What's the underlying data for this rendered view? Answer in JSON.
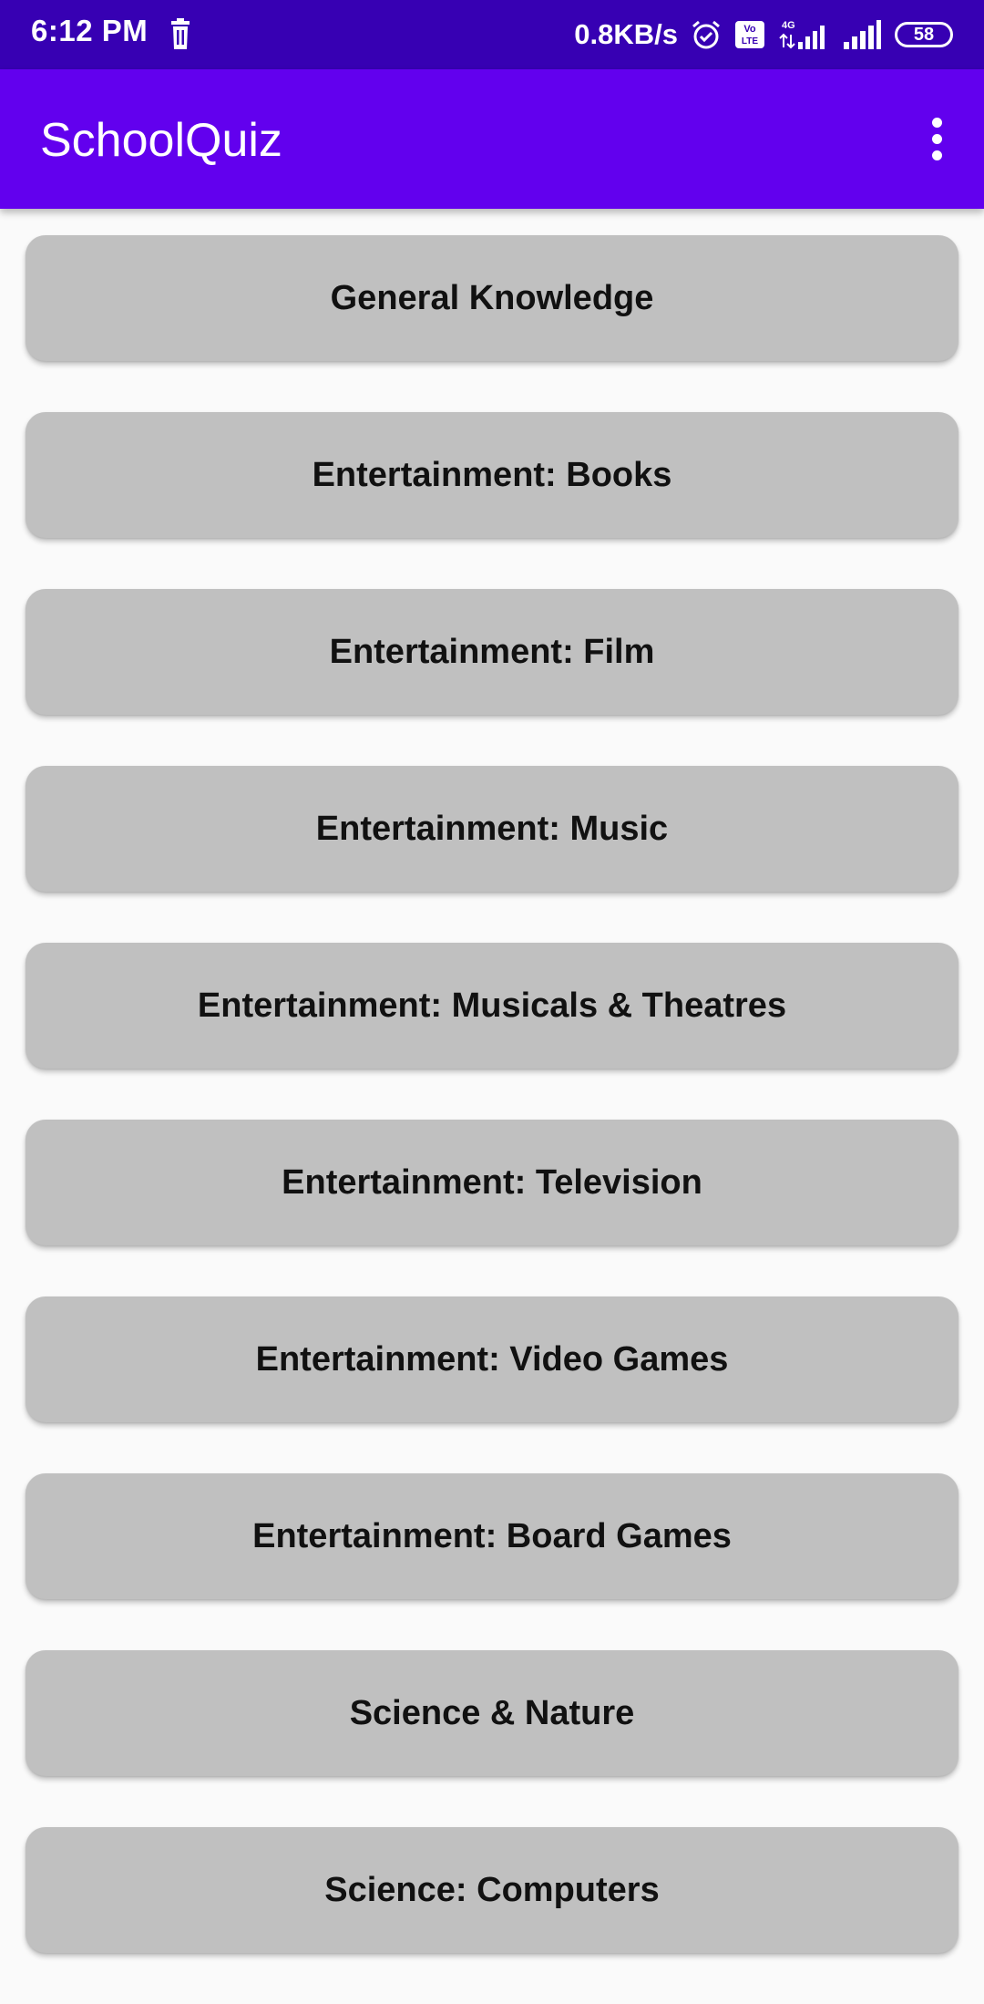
{
  "status_bar": {
    "time": "6:12 PM",
    "net_speed": "0.8KB/s",
    "volte": "Vo LTE",
    "network_type": "4G",
    "battery": "58"
  },
  "app_bar": {
    "title": "SchoolQuiz"
  },
  "categories": [
    "General Knowledge",
    "Entertainment: Books",
    "Entertainment: Film",
    "Entertainment: Music",
    "Entertainment: Musicals & Theatres",
    "Entertainment: Television",
    "Entertainment: Video Games",
    "Entertainment: Board Games",
    "Science & Nature",
    "Science: Computers"
  ],
  "colors": {
    "status_bar": "#3700b3",
    "app_bar": "#6200ee",
    "button": "#c0c0c0",
    "background": "#fafafa"
  }
}
